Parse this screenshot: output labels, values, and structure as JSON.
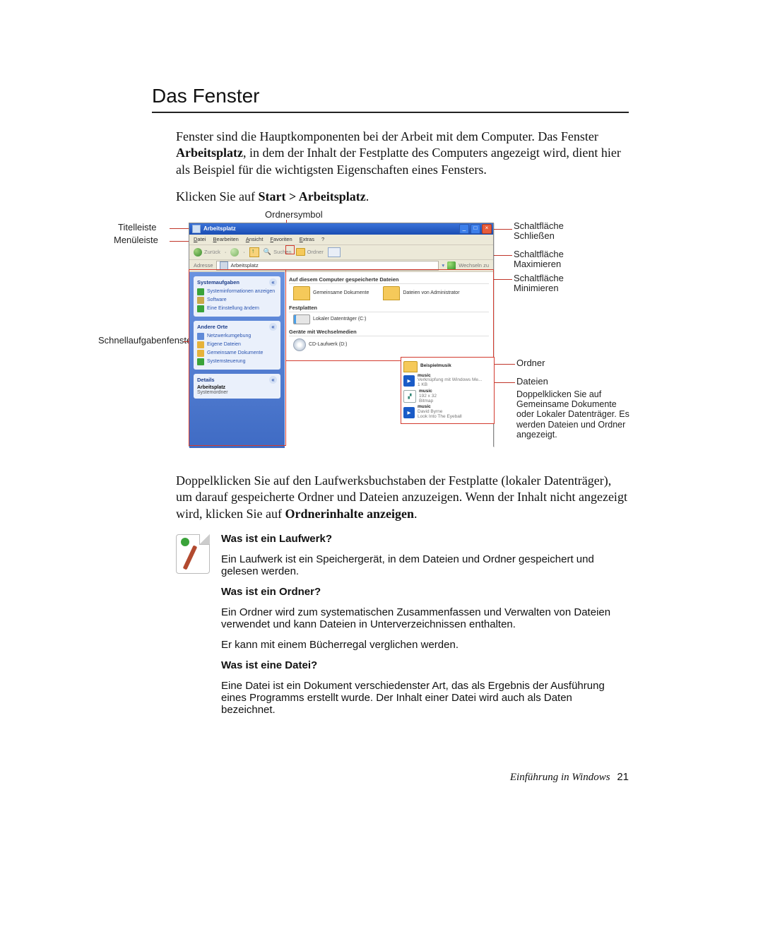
{
  "heading": "Das Fenster",
  "intro": {
    "p1a": "Fenster sind die Hauptkomponenten bei der Arbeit mit dem Computer. Das Fenster ",
    "p1b": "Arbeitsplatz",
    "p1c": ", in dem der Inhalt der Festplatte des Computers angezeigt wird, dient hier als Beispiel für die wichtigsten Eigenschaften eines Fensters.",
    "p2a": "Klicken Sie auf ",
    "p2b": "Start > Arbeitsplatz",
    "p2c": "."
  },
  "callouts": {
    "ordnersymbol": "Ordnersymbol",
    "titelleiste": "Titelleiste",
    "menuleiste": "Menüleiste",
    "schnell": "Schnellaufgabenfenster",
    "btn_close": "Schaltfläche Schließen",
    "btn_max": "Schaltfläche Maximieren",
    "btn_min": "Schaltfläche Minimieren",
    "ordner": "Ordner",
    "dateien": "Dateien",
    "dateien_desc": "Doppelklicken Sie auf Gemeinsame Dokumente oder Lokaler Datenträger. Es werden Dateien und Ordner angezeigt."
  },
  "shot": {
    "title": "Arbeitsplatz",
    "menu": [
      "Datei",
      "Bearbeiten",
      "Ansicht",
      "Favoriten",
      "Extras",
      "?"
    ],
    "toolbar": {
      "back": "Zurück",
      "search": "Suchen",
      "folders": "Ordner"
    },
    "addr": {
      "label": "Adresse",
      "value": "Arbeitsplatz",
      "go": "Wechseln zu"
    },
    "task1": {
      "hd": "Systemaufgaben",
      "items": [
        "Systeminformationen anzeigen",
        "Software",
        "Eine Einstellung ändern"
      ]
    },
    "task2": {
      "hd": "Andere Orte",
      "items": [
        "Netzwerkumgebung",
        "Eigene Dateien",
        "Gemeinsame Dokumente",
        "Systemsteuerung"
      ]
    },
    "task3": {
      "hd": "Details",
      "l1": "Arbeitsplatz",
      "l2": "Systemordner"
    },
    "sections": {
      "s1": "Auf diesem Computer gespeicherte Dateien",
      "s2": "Festplatten",
      "s3": "Geräte mit Wechselmedien",
      "i1": "Gemeinsame Dokumente",
      "i2": "Dateien von Administrator",
      "i3": "Lokaler Datenträger (C:)",
      "i4": "CD-Laufwerk (D:)"
    },
    "files": {
      "f0": "Beispielmusik",
      "f1a": "music",
      "f1b": "Verknüpfung mit Windows Me...",
      "f1c": "1 KB",
      "f2a": "music",
      "f2b": "192 x 32",
      "f2c": "Bitmap",
      "f3a": "music",
      "f3b": "David Byrne",
      "f3c": "Look Into The Eyeball"
    }
  },
  "after": {
    "p1a": "Doppelklicken Sie auf den Laufwerksbuchstaben der Festplatte (lokaler Datenträger), um darauf gespeicherte Ordner und Dateien anzuzeigen. Wenn der Inhalt nicht angezeigt wird, klicken Sie auf ",
    "p1b": "Ordnerinhalte anzeigen",
    "p1c": "."
  },
  "tip": {
    "q1": "Was ist ein Laufwerk?",
    "a1": "Ein Laufwerk ist ein Speichergerät, in dem Dateien und Ordner gespeichert und gelesen werden.",
    "q2": "Was ist ein Ordner?",
    "a2": "Ein Ordner wird zum systematischen Zusammenfassen und Verwalten von Dateien verwendet und kann Dateien in Unterverzeichnissen enthalten.",
    "a2b": "Er kann mit einem Bücherregal verglichen werden.",
    "q3": "Was ist eine Datei?",
    "a3": "Eine Datei ist ein Dokument verschiedenster Art, das als Ergebnis der Ausführung eines Programms erstellt wurde. Der Inhalt einer Datei wird auch als Daten bezeichnet."
  },
  "footer": {
    "text": "Einführung in Windows",
    "page": "21"
  }
}
